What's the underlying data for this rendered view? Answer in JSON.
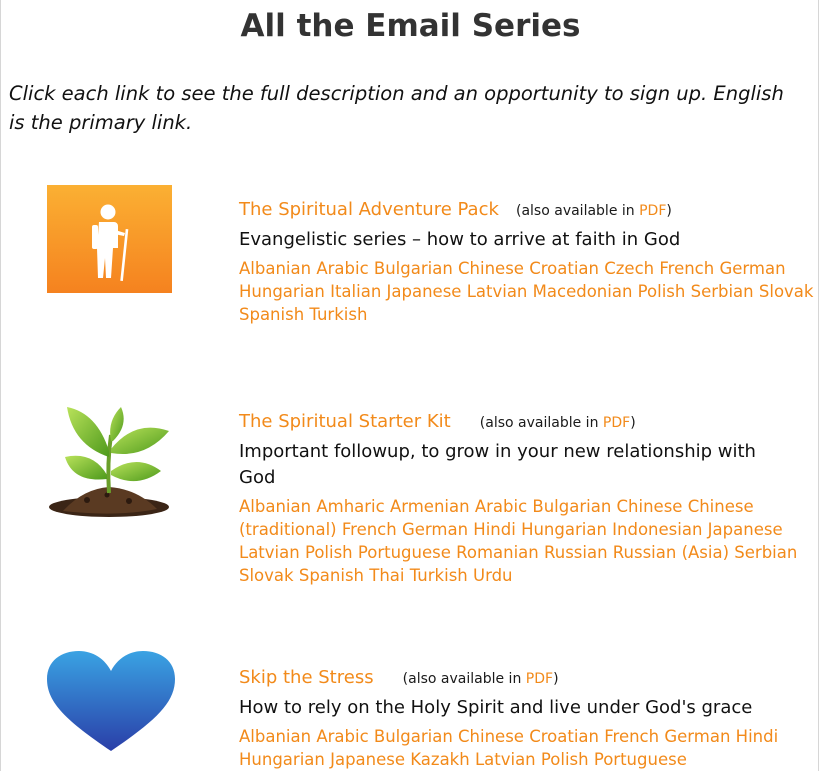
{
  "page": {
    "title": "All the Email Series",
    "intro": "Click each link to see the full description and an opportunity to sign up. English is the primary link."
  },
  "colors": {
    "link": "#f28a1a",
    "text": "#111111",
    "heading": "#333333"
  },
  "series": [
    {
      "icon": "hiker-icon",
      "title": "The Spiritual Adventure Pack",
      "also_prefix": "(also available in ",
      "also_link": "PDF",
      "also_suffix": ")",
      "description": "Evangelistic series – how to arrive at faith in God",
      "languages": [
        "Albanian",
        "Arabic",
        "Bulgarian",
        "Chinese",
        "Croatian",
        "Czech",
        "French",
        "German",
        "Hungarian",
        "Italian",
        "Japanese",
        "Latvian",
        "Macedonian",
        "Polish",
        "Serbian",
        "Slovak",
        "Spanish",
        "Turkish"
      ]
    },
    {
      "icon": "seedling-icon",
      "title": "The Spiritual Starter Kit",
      "also_prefix": "(also available in ",
      "also_link": "PDF",
      "also_suffix": ")",
      "description": "Important followup, to grow in your new relationship with God",
      "languages": [
        "Albanian",
        "Amharic",
        "Armenian",
        "Arabic",
        "Bulgarian",
        "Chinese",
        "Chinese (traditional)",
        "French",
        "German",
        "Hindi",
        "Hungarian",
        "Indonesian",
        "Japanese",
        "Latvian",
        "Polish",
        "Portuguese",
        "Romanian",
        "Russian",
        "Russian (Asia)",
        "Serbian",
        "Slovak",
        "Spanish",
        "Thai",
        "Turkish",
        "Urdu"
      ]
    },
    {
      "icon": "heart-icon",
      "title": "Skip the Stress",
      "also_prefix": "(also available in ",
      "also_link": "PDF",
      "also_suffix": ")",
      "description": "How to rely on the Holy Spirit and live under God's grace",
      "languages": [
        "Albanian",
        "Arabic",
        "Bulgarian",
        "Chinese",
        "Croatian",
        "French",
        "German",
        "Hindi",
        "Hungarian",
        "Japanese",
        "Kazakh",
        "Latvian",
        "Polish",
        "Portuguese"
      ]
    }
  ]
}
